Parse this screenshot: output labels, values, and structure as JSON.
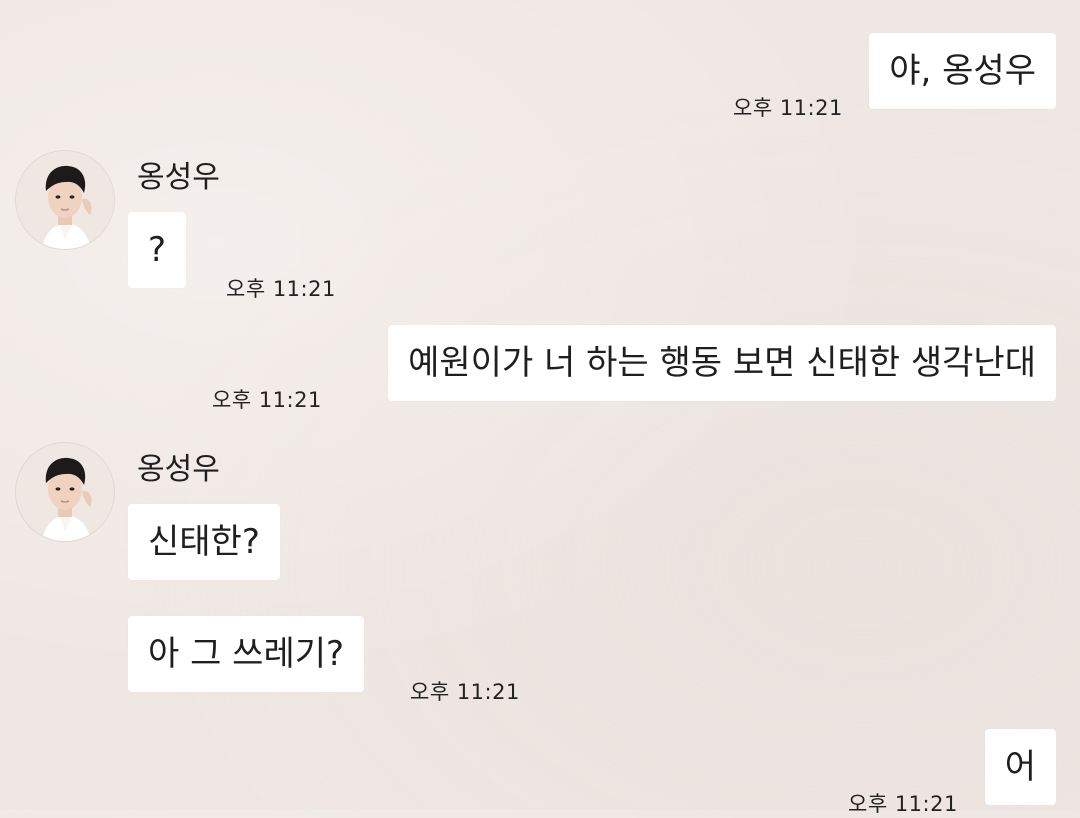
{
  "messages": [
    {
      "text": "야, 옹성우",
      "time": "오후 11:21"
    },
    {
      "sender": "옹성우",
      "text": "?",
      "time": "오후 11:21"
    },
    {
      "text": "예원이가 너 하는 행동 보면 신태한 생각난대",
      "time": "오후 11:21"
    },
    {
      "sender": "옹성우",
      "text": "신태한?"
    },
    {
      "text": "아 그 쓰레기?",
      "time": "오후 11:21"
    },
    {
      "text": "어",
      "time": "오후 11:21"
    }
  ]
}
